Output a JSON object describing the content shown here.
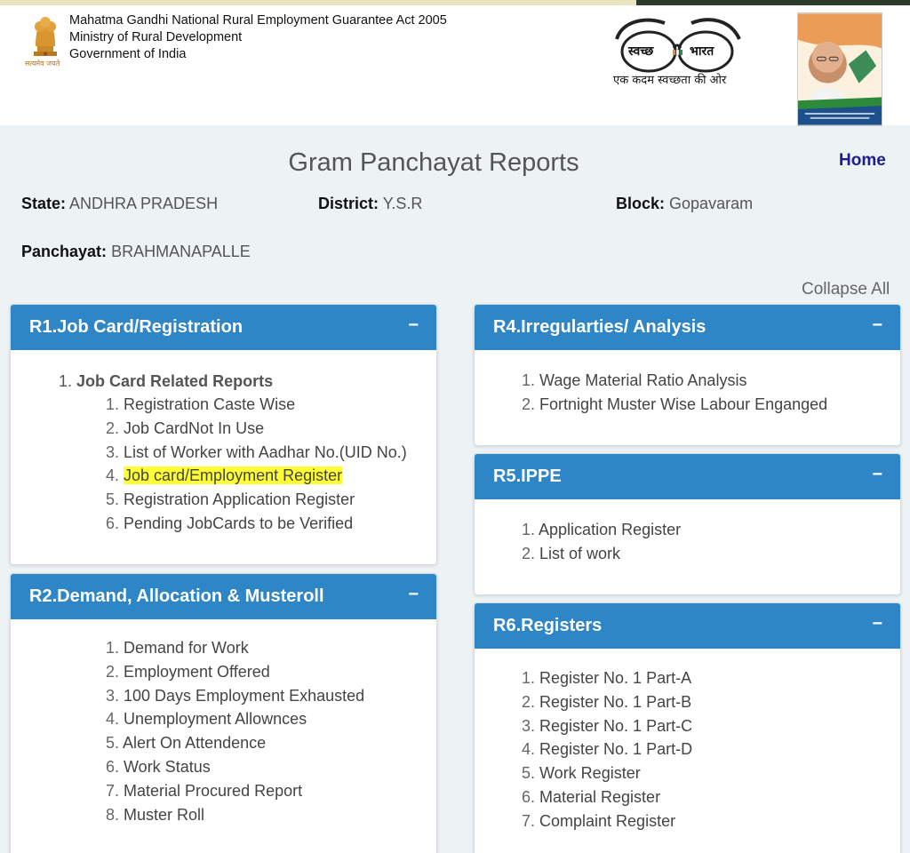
{
  "header": {
    "lines": [
      "Mahatma Gandhi National Rural Employment Guarantee Act 2005",
      "Ministry of Rural Development",
      "Government of India"
    ],
    "emblem_motto": "सत्यमेव जयते",
    "swachh_left": "स्वच्छ",
    "swachh_right": "भारत",
    "swachh_tagline": "एक कदम स्वच्छता की ओर"
  },
  "page": {
    "title": "Gram Panchayat Reports",
    "home_label": "Home",
    "collapse_all_label": "Collapse All"
  },
  "meta": {
    "state_label": "State:",
    "state_value": "ANDHRA PRADESH",
    "district_label": "District:",
    "district_value": "Y.S.R",
    "block_label": "Block:",
    "block_value": "Gopavaram",
    "panchayat_label": "Panchayat:",
    "panchayat_value": "BRAHMANAPALLE"
  },
  "panels": {
    "r1": {
      "title": "R1.Job Card/Registration",
      "toggle": "−",
      "section_num": "1.",
      "section_title": "Job Card Related Reports",
      "items": [
        "Registration Caste Wise",
        "Job CardNot In Use",
        "List of Worker with Aadhar No.(UID No.)",
        "Job card/Employment Register",
        "Registration Application Register",
        "Pending JobCards to be Verified"
      ]
    },
    "r2": {
      "title": "R2.Demand, Allocation & Musteroll",
      "toggle": "−",
      "items": [
        "Demand for Work",
        "Employment Offered",
        "100 Days Employment Exhausted",
        "Unemployment Allownces",
        "Alert On Attendence",
        "Work Status",
        "Material Procured Report",
        "Muster Roll"
      ]
    },
    "r4": {
      "title": "R4.Irregularties/ Analysis",
      "toggle": "−",
      "items": [
        "Wage Material Ratio Analysis",
        "Fortnight Muster Wise Labour Enganged"
      ]
    },
    "r5": {
      "title": "R5.IPPE",
      "toggle": "−",
      "items": [
        "Application Register",
        "List of work"
      ]
    },
    "r6": {
      "title": "R6.Registers",
      "toggle": "−",
      "items": [
        "Register No. 1 Part-A",
        "Register No. 1 Part-B",
        "Register No. 1 Part-C",
        "Register No. 1 Part-D",
        "Work Register",
        "Material Register",
        "Complaint Register"
      ]
    }
  },
  "colors": {
    "panel_header": "#2e86c6",
    "home_link": "#1b1e8c",
    "highlight": "#ffff33",
    "page_bg": "#edf2f5"
  },
  "icons": {
    "emblem": "national-emblem-icon",
    "swachh": "swachh-bharat-spectacles-icon",
    "gandhi": "gandhi-portrait-icon"
  }
}
